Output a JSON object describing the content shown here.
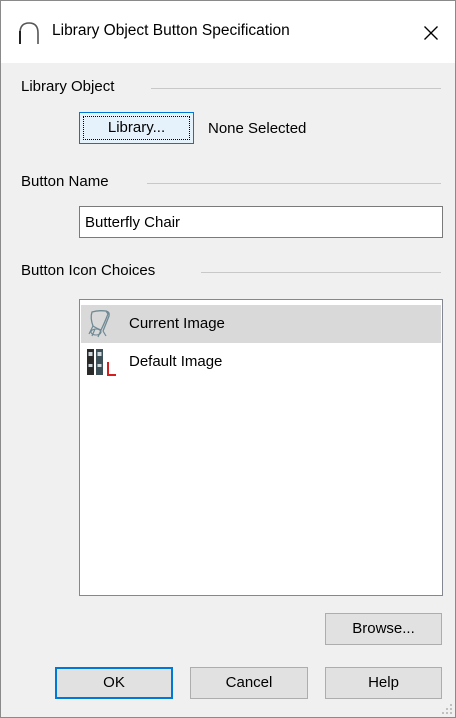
{
  "window": {
    "title": "Library Object Button Specification"
  },
  "library_object": {
    "group_label": "Library Object",
    "library_button_label": "Library...",
    "selection_status": "None Selected"
  },
  "button_name": {
    "group_label": "Button Name",
    "value": "Butterfly Chair"
  },
  "icon_choices": {
    "group_label": "Button Icon Choices",
    "items": [
      {
        "label": "Current Image",
        "icon": "butterfly-chair-icon",
        "selected": true
      },
      {
        "label": "Default Image",
        "icon": "library-books-icon",
        "selected": false
      }
    ],
    "browse_label": "Browse..."
  },
  "footer": {
    "ok_label": "OK",
    "cancel_label": "Cancel",
    "help_label": "Help"
  },
  "colors": {
    "accent": "#0078d7",
    "selection": "#d9d9d9",
    "dialog_bg": "#f0f0f0",
    "icon_red": "#d21f1f"
  }
}
